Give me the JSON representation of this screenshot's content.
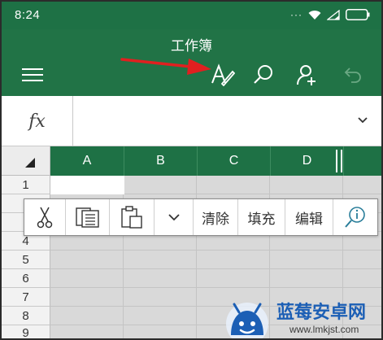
{
  "status": {
    "time": "8:24",
    "dots": "···"
  },
  "app": {
    "title": "工作簿"
  },
  "toolbar": {
    "menu_icon": "hamburger-icon",
    "edit_icon": "pen-edit-icon",
    "search_icon": "search-icon",
    "share_icon": "add-person-icon",
    "undo_icon": "undo-icon"
  },
  "formula_bar": {
    "fx_label": "fx",
    "value": ""
  },
  "sheet": {
    "columns": [
      "A",
      "B",
      "C",
      "D"
    ],
    "rows": [
      "1",
      "4",
      "5",
      "6",
      "7",
      "8",
      "9"
    ],
    "selected_cell": "A1"
  },
  "context_menu": {
    "items": [
      {
        "kind": "icon",
        "icon": "scissors-cut-icon"
      },
      {
        "kind": "icon",
        "icon": "copy-icon"
      },
      {
        "kind": "icon",
        "icon": "paste-icon"
      },
      {
        "kind": "icon",
        "icon": "chevron-down-icon"
      },
      {
        "kind": "text",
        "label": "清除"
      },
      {
        "kind": "text",
        "label": "填充"
      },
      {
        "kind": "text",
        "label": "编辑"
      },
      {
        "kind": "icon",
        "icon": "smart-lookup-icon"
      }
    ]
  },
  "watermark": {
    "text": "蓝莓安卓网",
    "url": "www.lmkjst.com"
  },
  "colors": {
    "header_green": "#217346",
    "status_green": "#1e7145",
    "arrow_red": "#e02020",
    "watermark_blue": "#1c5fb5"
  }
}
